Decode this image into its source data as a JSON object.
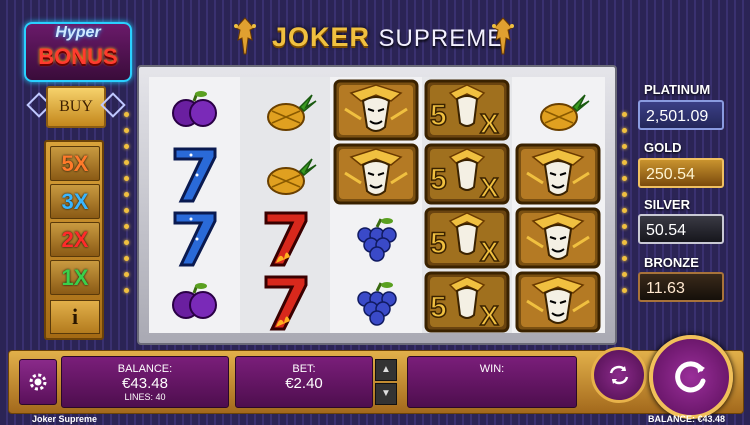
{
  "game": {
    "title_part1": "JOKER",
    "title_part2": "SUPREME",
    "footer_title": "Joker Supreme"
  },
  "hyper_bonus": {
    "line1": "Hyper",
    "line2": "BONUS",
    "buy_label": "BUY"
  },
  "multipliers": [
    "5X",
    "3X",
    "2X",
    "1X"
  ],
  "multiplier_colors": [
    "#ff7a2a",
    "#39b6ff",
    "#ff2a2a",
    "#3ad04a"
  ],
  "info_label": "i",
  "jackpots": {
    "platinum": {
      "label": "PLATINUM",
      "value": "2,501.09"
    },
    "gold": {
      "label": "GOLD",
      "value": "250.54"
    },
    "silver": {
      "label": "SILVER",
      "value": "50.54"
    },
    "bronze": {
      "label": "BRONZE",
      "value": "11.63"
    }
  },
  "reels": [
    [
      "plum",
      "seven",
      "seven",
      "plum"
    ],
    [
      "pineapple",
      "pineapple",
      "red-seven",
      "red-seven"
    ],
    [
      "joker",
      "joker",
      "grapes",
      "grapes"
    ],
    [
      "5x",
      "5x",
      "5x",
      "5x"
    ],
    [
      "pineapple",
      "joker",
      "joker",
      "joker"
    ]
  ],
  "bottom": {
    "balance_label": "BALANCE:",
    "balance_value": "€43.48",
    "lines_label": "LINES: 40",
    "bet_label": "BET:",
    "bet_value": "€2.40",
    "win_label": "WIN:",
    "footer_balance": "BALANCE: €43.48"
  },
  "icons": [
    "gear-icon",
    "autoplay-icon",
    "spin-icon",
    "up-arrow-icon",
    "down-arrow-icon",
    "jester-icon"
  ]
}
